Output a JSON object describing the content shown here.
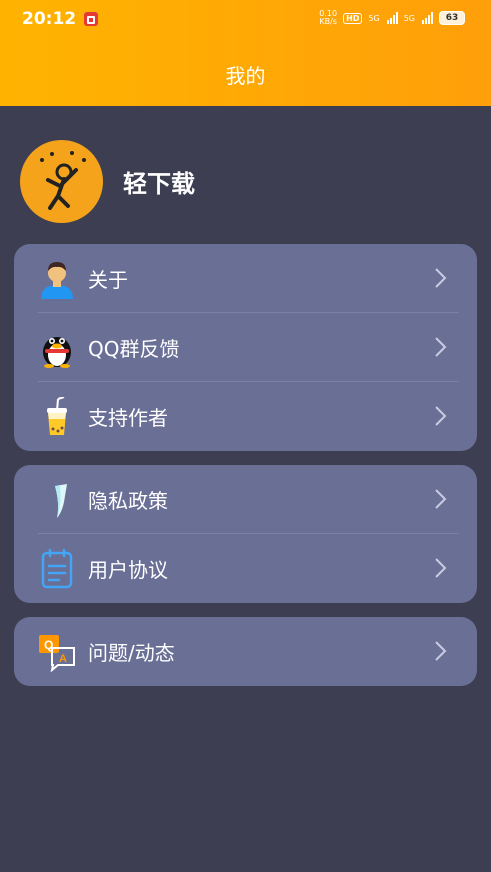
{
  "status_bar": {
    "time": "20:12",
    "net_speed_value": "0.10",
    "net_speed_unit": "KB/s",
    "hd_label": "HD",
    "signal1_label": "5G",
    "signal2_label": "5G",
    "battery": "63"
  },
  "header": {
    "title": "我的"
  },
  "profile": {
    "app_name": "轻下载"
  },
  "menu": {
    "about": "关于",
    "qq_group": "QQ群反馈",
    "support": "支持作者",
    "privacy": "隐私政策",
    "agreement": "用户协议",
    "faq": "问题/动态"
  },
  "colors": {
    "header_start": "#ffb300",
    "header_end": "#ff9f0a",
    "background": "#3d3e52",
    "card": "#6a6f96"
  }
}
